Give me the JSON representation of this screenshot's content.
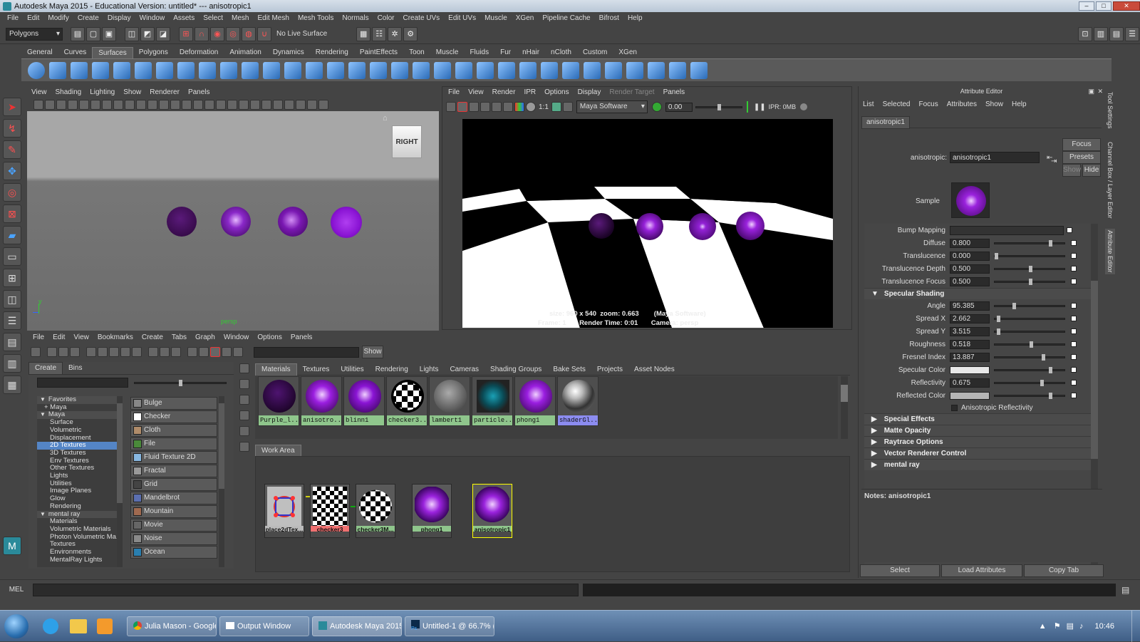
{
  "window": {
    "title": "Autodesk Maya 2015 - Educational Version: untitled*   ---   anisotropic1",
    "controls": [
      "–",
      "□",
      "✕"
    ]
  },
  "menubar": [
    "File",
    "Edit",
    "Modify",
    "Create",
    "Display",
    "Window",
    "Assets",
    "Select",
    "Mesh",
    "Edit Mesh",
    "Mesh Tools",
    "Normals",
    "Color",
    "Create UVs",
    "Edit UVs",
    "Muscle",
    "XGen",
    "Pipeline Cache",
    "Bifrost",
    "Help"
  ],
  "statusline": {
    "mode": "Polygons",
    "live_surface": "No Live Surface"
  },
  "shelf_tabs": [
    "General",
    "Curves",
    "Surfaces",
    "Polygons",
    "Deformation",
    "Animation",
    "Dynamics",
    "Rendering",
    "PaintEffects",
    "Toon",
    "Muscle",
    "Fluids",
    "Fur",
    "nHair",
    "nCloth",
    "Custom",
    "XGen"
  ],
  "shelf_active": "Surfaces",
  "viewport": {
    "menu": [
      "View",
      "Shading",
      "Lighting",
      "Show",
      "Renderer",
      "Panels"
    ],
    "camera": "persp",
    "viewcube": "RIGHT",
    "axis_y": "y",
    "axis_x": "x"
  },
  "render_view": {
    "menu": [
      "File",
      "View",
      "Render",
      "IPR",
      "Options",
      "Display",
      "Render Target",
      "Panels"
    ],
    "renderer": "Maya Software",
    "ratio": "1:1",
    "exposure": "0.00",
    "ipr": "IPR: 0MB",
    "info1": "size: 960 x 540  zoom: 0.663        (Maya Software)",
    "info2": "Frame: 1       Render Time: 0:01       Camera: persp"
  },
  "attribute_editor": {
    "title": "Attribute Editor",
    "menu": [
      "List",
      "Selected",
      "Focus",
      "Attributes",
      "Show",
      "Help"
    ],
    "tab": "anisotropic1",
    "node_label": "anisotropic:",
    "node_value": "anisotropic1",
    "focus_btn": "Focus",
    "presets_btn": "Presets",
    "show_btn": "Show",
    "hide_btn": "Hide",
    "sample_label": "Sample",
    "attrs_top": [
      {
        "label": "Bump Mapping",
        "value": ""
      },
      {
        "label": "Diffuse",
        "value": "0.800"
      },
      {
        "label": "Translucence",
        "value": "0.000"
      },
      {
        "label": "Translucence Depth",
        "value": "0.500"
      },
      {
        "label": "Translucence Focus",
        "value": "0.500"
      }
    ],
    "specular_section": "Specular Shading",
    "attrs_spec": [
      {
        "label": "Angle",
        "value": "95.385"
      },
      {
        "label": "Spread X",
        "value": "2.662"
      },
      {
        "label": "Spread Y",
        "value": "3.515"
      },
      {
        "label": "Roughness",
        "value": "0.518"
      },
      {
        "label": "Fresnel Index",
        "value": "13.887"
      },
      {
        "label": "Specular Color",
        "value": ""
      },
      {
        "label": "Reflectivity",
        "value": "0.675"
      },
      {
        "label": "Reflected Color",
        "value": ""
      }
    ],
    "aniso_reflectivity": "Anisotropic Reflectivity",
    "sections": [
      "Special Effects",
      "Matte Opacity",
      "Raytrace Options",
      "Vector Renderer Control",
      "mental ray"
    ],
    "notes": "Notes:  anisotropic1",
    "bottom_buttons": [
      "Select",
      "Load Attributes",
      "Copy Tab"
    ]
  },
  "side_tabs": [
    "Tool Settings",
    "Channel Box / Layer Editor",
    "Attribute Editor"
  ],
  "hypershade": {
    "menu": [
      "File",
      "Edit",
      "View",
      "Bookmarks",
      "Create",
      "Tabs",
      "Graph",
      "Window",
      "Options",
      "Panels"
    ],
    "show_btn": "Show",
    "left_tabs": [
      "Create",
      "Bins"
    ],
    "tree": [
      {
        "label": "Favorites",
        "level": 0,
        "open": true
      },
      {
        "label": "+ Maya",
        "level": 1
      },
      {
        "label": "Maya",
        "level": 0,
        "open": true
      },
      {
        "label": "Surface",
        "level": 2
      },
      {
        "label": "Volumetric",
        "level": 2
      },
      {
        "label": "Displacement",
        "level": 2
      },
      {
        "label": "2D Textures",
        "level": 2,
        "selected": true
      },
      {
        "label": "3D Textures",
        "level": 2
      },
      {
        "label": "Env Textures",
        "level": 2
      },
      {
        "label": "Other Textures",
        "level": 2
      },
      {
        "label": "Lights",
        "level": 2
      },
      {
        "label": "Utilities",
        "level": 2
      },
      {
        "label": "Image Planes",
        "level": 2
      },
      {
        "label": "Glow",
        "level": 2
      },
      {
        "label": "Rendering",
        "level": 2
      },
      {
        "label": "mental ray",
        "level": 0,
        "open": true
      },
      {
        "label": "Materials",
        "level": 2
      },
      {
        "label": "Volumetric Materials",
        "level": 2
      },
      {
        "label": "Photon Volumetric Ma...",
        "level": 2
      },
      {
        "label": "Textures",
        "level": 2
      },
      {
        "label": "Environments",
        "level": 2
      },
      {
        "label": "MentalRay Lights",
        "level": 2
      }
    ],
    "create_nodes": [
      {
        "label": "Bulge",
        "color": "#888888"
      },
      {
        "label": "Checker",
        "color": "#ffffff"
      },
      {
        "label": "Cloth",
        "color": "#b08c6a"
      },
      {
        "label": "File",
        "color": "#4a8a3a"
      },
      {
        "label": "Fluid Texture 2D",
        "color": "#87b7e0"
      },
      {
        "label": "Fractal",
        "color": "#999999"
      },
      {
        "label": "Grid",
        "color": "#444444"
      },
      {
        "label": "Mandelbrot",
        "color": "#5b6fb0"
      },
      {
        "label": "Mountain",
        "color": "#a06a50"
      },
      {
        "label": "Movie",
        "color": "#666666"
      },
      {
        "label": "Noise",
        "color": "#8a8a8a"
      },
      {
        "label": "Ocean",
        "color": "#2a7fb0"
      }
    ],
    "tabs": [
      "Materials",
      "Textures",
      "Utilities",
      "Rendering",
      "Lights",
      "Cameras",
      "Shading Groups",
      "Bake Sets",
      "Projects",
      "Asset Nodes"
    ],
    "active_tab": "Materials",
    "materials": [
      {
        "label": "Purple_l...",
        "color": "#3c0c5a",
        "type": "sphere"
      },
      {
        "label": "anisotro...",
        "color": "#9b1ee0",
        "type": "sphere"
      },
      {
        "label": "blinn1",
        "color": "#8a14d4",
        "type": "sphere"
      },
      {
        "label": "checker3...",
        "color": "#ffffff",
        "type": "checker"
      },
      {
        "label": "lambert1",
        "color": "#7a7a7a",
        "type": "sphere"
      },
      {
        "label": "particle...",
        "color": "#1aa0b5",
        "type": "particle"
      },
      {
        "label": "phong1",
        "color": "#9a1ee0",
        "type": "sphere"
      },
      {
        "label": "shaderGl...",
        "color": "#aaaaaa",
        "type": "chrome"
      }
    ],
    "work_area_tab": "Work Area",
    "work_nodes": [
      {
        "label": "place2dTex...",
        "type": "place2d"
      },
      {
        "label": "checker3",
        "type": "checker"
      },
      {
        "label": "checker3M...",
        "type": "checkersphere"
      },
      {
        "label": "phong1",
        "type": "purple"
      },
      {
        "label": "anisotropic1",
        "type": "purple"
      }
    ]
  },
  "mel": {
    "label": "MEL"
  },
  "taskbar": {
    "tasks": [
      "Julia Mason - Google...",
      "Output Window",
      "Autodesk Maya 2015...",
      "Untitled-1 @ 66.7% (..."
    ],
    "clock": "10:46"
  },
  "colors": {
    "maya_bg": "#444444",
    "selection": "#5485c6",
    "purple": "#9b1ee0"
  }
}
